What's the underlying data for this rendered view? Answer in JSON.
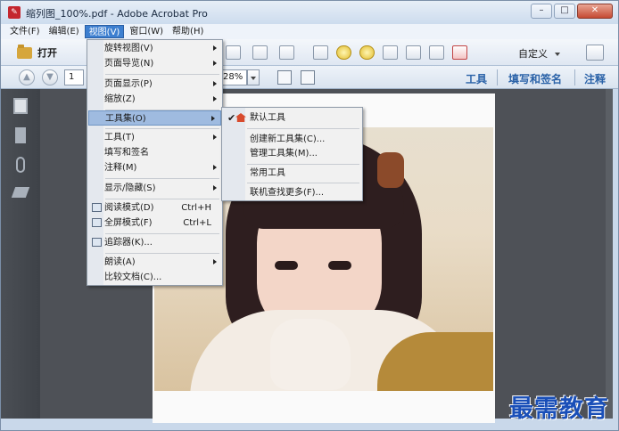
{
  "window": {
    "title": "缩列图_100%.pdf - Adobe Acrobat Pro",
    "min": "–",
    "max": "□",
    "close": "✕"
  },
  "menubar": [
    "文件(F)",
    "编辑(E)",
    "视图(V)",
    "窗口(W)",
    "帮助(H)"
  ],
  "toolbar": {
    "open_label": "打开",
    "customize_label": "自定义"
  },
  "nav": {
    "page_value": "1",
    "zoom_value": "28%"
  },
  "panes": [
    "工具",
    "填写和签名",
    "注释"
  ],
  "view_menu": [
    {
      "label": "旋转视图(V)",
      "submenu": true
    },
    {
      "label": "页面导览(N)",
      "submenu": true
    },
    {
      "label": "页面显示(P)",
      "submenu": true
    },
    {
      "label": "缩放(Z)",
      "submenu": true
    },
    {
      "label": "工具集(O)",
      "submenu": true,
      "highlighted": true
    },
    {
      "label": "工具(T)",
      "submenu": true
    },
    {
      "label": "填写和签名",
      "submenu": false
    },
    {
      "label": "注释(M)",
      "submenu": true
    },
    {
      "label": "显示/隐藏(S)",
      "submenu": true
    },
    {
      "label": "阅读模式(D)",
      "shortcut": "Ctrl+H"
    },
    {
      "label": "全屏模式(F)",
      "shortcut": "Ctrl+L"
    },
    {
      "label": "追踪器(K)..."
    },
    {
      "label": "朗读(A)",
      "submenu": true
    },
    {
      "label": "比较文档(C)..."
    }
  ],
  "toolset_submenu": [
    {
      "label": "默认工具",
      "checked": true
    },
    {
      "label": "创建新工具集(C)..."
    },
    {
      "label": "管理工具集(M)..."
    },
    {
      "label": "常用工具"
    },
    {
      "label": "联机查找更多(F)..."
    }
  ],
  "watermark": "最需教育"
}
